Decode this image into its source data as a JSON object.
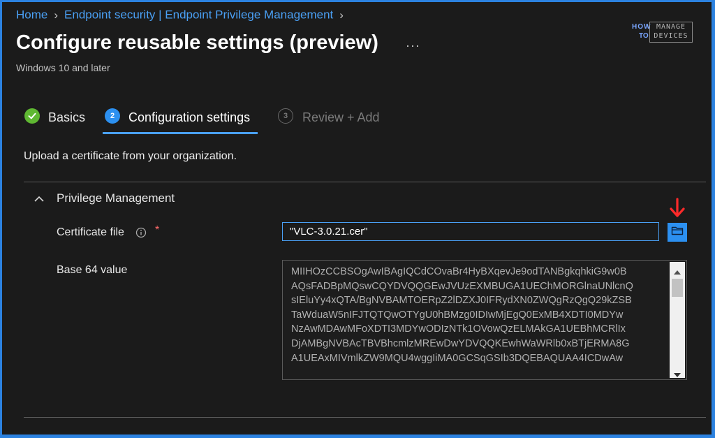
{
  "breadcrumb": {
    "items": [
      "Home",
      "Endpoint security | Endpoint Privilege Management"
    ]
  },
  "header": {
    "title": "Configure reusable settings (preview)",
    "more_label": "···",
    "subtitle": "Windows 10 and later"
  },
  "logo": {
    "line1": "HOW",
    "line2": "TO",
    "box_line1": "MANAGE",
    "box_line2": "DEVICES"
  },
  "steps": [
    {
      "number": "",
      "label": "Basics",
      "state": "completed"
    },
    {
      "number": "2",
      "label": "Configuration settings",
      "state": "active"
    },
    {
      "number": "3",
      "label": "Review + Add",
      "state": "disabled"
    }
  ],
  "description": "Upload a certificate from your organization.",
  "section": {
    "title": "Privilege Management",
    "expanded": true
  },
  "fields": {
    "certificate_label": "Certificate file",
    "required_mark": "*",
    "certificate_value": "\"VLC-3.0.21.cer\"",
    "base64_label": "Base 64 value",
    "base64_lines": [
      "MIIHOzCCBSOgAwIBAgIQCdCOvaBr4HyBXqevJe9odTANBgkqhkiG9w0B",
      "AQsFADBpMQswCQYDVQQGEwJVUzEXMBUGA1UEChMORGlnaUNlcnQ",
      "sIEluYy4xQTA/BgNVBAMTOERpZ2lDZXJ0IFRydXN0ZWQgRzQgQ29kZSB",
      "TaWduaW5nIFJTQTQwOTYgU0hBMzg0IDIwMjEgQ0ExMB4XDTI0MDYw",
      "NzAwMDAwMFoXDTI3MDYwODIzNTk1OVowQzELMAkGA1UEBhMCRlIx",
      "DjAMBgNVBAcTBVBhcmlzMREwDwYDVQQKEwhWaWRlb0xBTjERMA8G",
      "A1UEAxMIVmlkZW9MQU4wggIiMA0GCSqGSIb3DQEBAQUAA4ICDwAw"
    ]
  },
  "colors": {
    "accent": "#4aa0f5",
    "success": "#5fb832",
    "required": "#ff6b6b",
    "annotation_arrow": "#ff2a2a",
    "frame": "#2c82e0"
  }
}
